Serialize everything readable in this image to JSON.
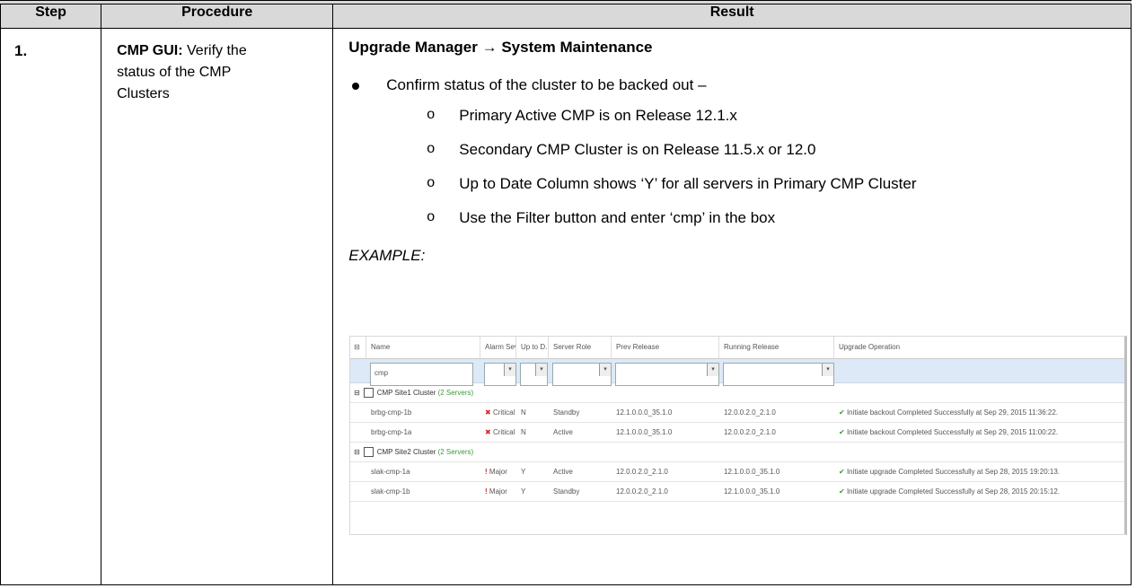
{
  "table": {
    "headers": {
      "step": "Step",
      "procedure": "Procedure",
      "result": "Result"
    },
    "step_number": "1.",
    "procedure": {
      "bold_prefix": "CMP GUI:",
      "text_line1": " Verify the",
      "text_line2": "status of the CMP",
      "text_line3": "Clusters"
    },
    "result": {
      "title": "Upgrade Manager → System Maintenance",
      "bullet": "Confirm status of the cluster to be backed out –",
      "subitems": [
        "Primary Active CMP is on Release 12.1.x",
        "Secondary CMP Cluster is  on Release 11.5.x or 12.0",
        "Up to Date Column shows ‘Y’ for all servers in Primary CMP Cluster",
        "Use the Filter button and enter ‘cmp’ in the box"
      ],
      "sub_marker": "o",
      "example_label": "EXAMPLE:"
    }
  },
  "screenshot": {
    "columns": [
      "Name",
      "Alarm Sev...",
      "Up to D...",
      "Server Role",
      "Prev Release",
      "Running Release",
      "Upgrade Operation"
    ],
    "filter_value": "cmp",
    "clusters": [
      {
        "name": "CMP Site1 Cluster",
        "count": "(2 Servers)",
        "rows": [
          {
            "name": "brbg-cmp-1b",
            "alarm": "Critical",
            "uptodate": "N",
            "role": "Standby",
            "prev": "12.1.0.0.0_35.1.0",
            "running": "12.0.0.2.0_2.1.0",
            "op": "Initiate backout Completed Successfully at Sep 29, 2015 11:36:22."
          },
          {
            "name": "brbg-cmp-1a",
            "alarm": "Critical",
            "uptodate": "N",
            "role": "Active",
            "prev": "12.1.0.0.0_35.1.0",
            "running": "12.0.0.2.0_2.1.0",
            "op": "Initiate backout Completed Successfully at Sep 29, 2015 11:00:22."
          }
        ]
      },
      {
        "name": "CMP Site2 Cluster",
        "count": "(2 Servers)",
        "rows": [
          {
            "name": "slak-cmp-1a",
            "alarm": "Major",
            "uptodate": "Y",
            "role": "Active",
            "prev": "12.0.0.2.0_2.1.0",
            "running": "12.1.0.0.0_35.1.0",
            "op": "Initiate upgrade Completed Successfully at Sep 28, 2015 19:20:13."
          },
          {
            "name": "slak-cmp-1b",
            "alarm": "Major",
            "uptodate": "Y",
            "role": "Standby",
            "prev": "12.0.0.2.0_2.1.0",
            "running": "12.1.0.0.0_35.1.0",
            "op": "Initiate upgrade Completed Successfully at Sep 28, 2015 20:15:12."
          }
        ]
      }
    ]
  }
}
